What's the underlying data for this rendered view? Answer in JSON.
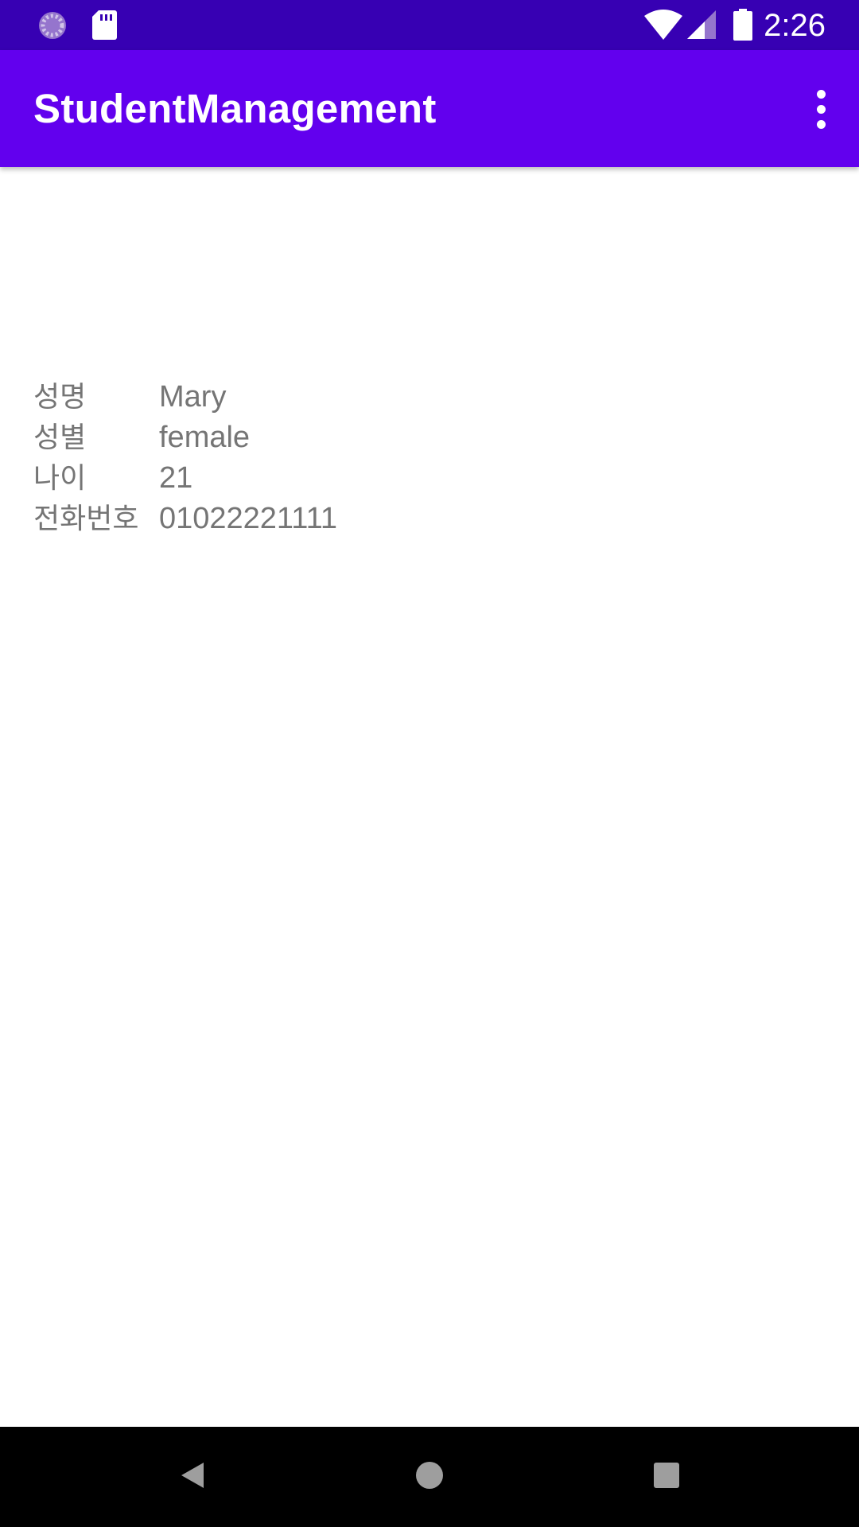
{
  "status_bar": {
    "time": "2:26",
    "icons": [
      "loading-circle-icon",
      "sd-card-icon",
      "wifi-icon",
      "signal-icon",
      "battery-icon"
    ]
  },
  "app_bar": {
    "title": "StudentManagement",
    "overflow_icon": "more-vert-icon"
  },
  "student": {
    "rows": [
      {
        "label": "성명",
        "value": "Mary"
      },
      {
        "label": "성별",
        "value": "female"
      },
      {
        "label": "나이",
        "value": "21"
      },
      {
        "label": "전화번호",
        "value": "01022221111"
      }
    ]
  },
  "nav_bar": {
    "icons": [
      "back-icon",
      "home-icon",
      "recents-icon"
    ]
  },
  "colors": {
    "status_bar": "#3700b3",
    "app_bar": "#6200ee",
    "text_secondary": "#757575",
    "nav_bar": "#000000"
  }
}
